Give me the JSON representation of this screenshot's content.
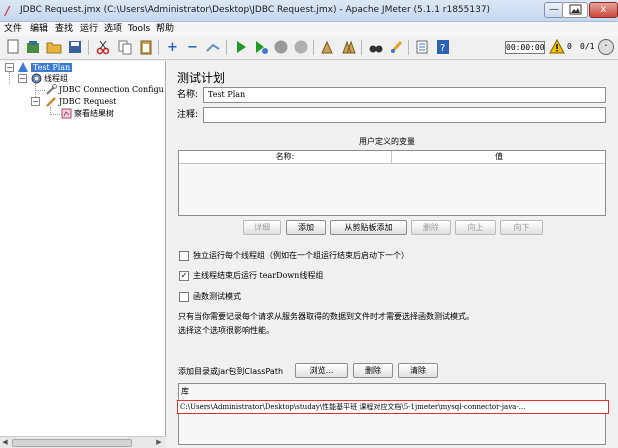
{
  "window": {
    "title": "JDBC Request.jmx (C:\\Users\\Administrator\\Desktop\\JDBC Request.jmx) - Apache JMeter (5.1.1 r1855137)",
    "min_label": "—",
    "close_label": "x"
  },
  "menu": [
    "文件",
    "编辑",
    "查找",
    "运行",
    "选项",
    "Tools",
    "帮助"
  ],
  "toolbar": {
    "timer": "00:00:00",
    "error_count": "0",
    "thread_count": "0/1"
  },
  "tree": {
    "nodes": [
      {
        "label": "Test Plan",
        "icon": "test-plan-icon"
      },
      {
        "label": "线程组",
        "icon": "gear-icon"
      },
      {
        "label": "JDBC Connection Configu",
        "icon": "wrench-icon"
      },
      {
        "label": "JDBC Request",
        "icon": "pencil-icon"
      },
      {
        "label": "察看结果树",
        "icon": "listener-icon"
      }
    ]
  },
  "main": {
    "heading": "测试计划",
    "name_label": "名称:",
    "name_value": "Test Plan",
    "comment_label": "注释:",
    "comment_value": "",
    "udv_title": "用户定义的变量",
    "columns": [
      "名称:",
      "值"
    ],
    "buttons": [
      {
        "label": "详细",
        "enabled": false
      },
      {
        "label": "添加",
        "enabled": true
      },
      {
        "label": "从剪贴板添加",
        "enabled": true
      },
      {
        "label": "删除",
        "enabled": false
      },
      {
        "label": "向上",
        "enabled": false
      },
      {
        "label": "向下",
        "enabled": false
      }
    ],
    "checkboxes": [
      {
        "label": "独立运行每个线程组（例如在一个组运行结束后启动下一个）",
        "checked": false
      },
      {
        "label": "主线程结束后运行 tearDown线程组",
        "checked": true
      },
      {
        "label": "函数测试模式",
        "checked": false
      }
    ],
    "description_lines": [
      "只有当你需要记录每个请求从服务器取得的数据到文件时才需要选择函数测试模式。",
      "选择这个选项很影响性能。"
    ],
    "classpath_label": "添加目录或jar包到ClassPath",
    "classpath_buttons": [
      "浏览...",
      "删除",
      "清除"
    ],
    "lib_header": "库",
    "lib_entry": "C:\\Users\\Administrator\\Desktop\\studay\\性能基平班 课程对应文档\\5-1jmeter\\mysql-connector-java-..."
  },
  "colors": {
    "selection": "#3a7ad1",
    "highlight_border": "#e03030",
    "run_green": "#1f9a2b"
  }
}
